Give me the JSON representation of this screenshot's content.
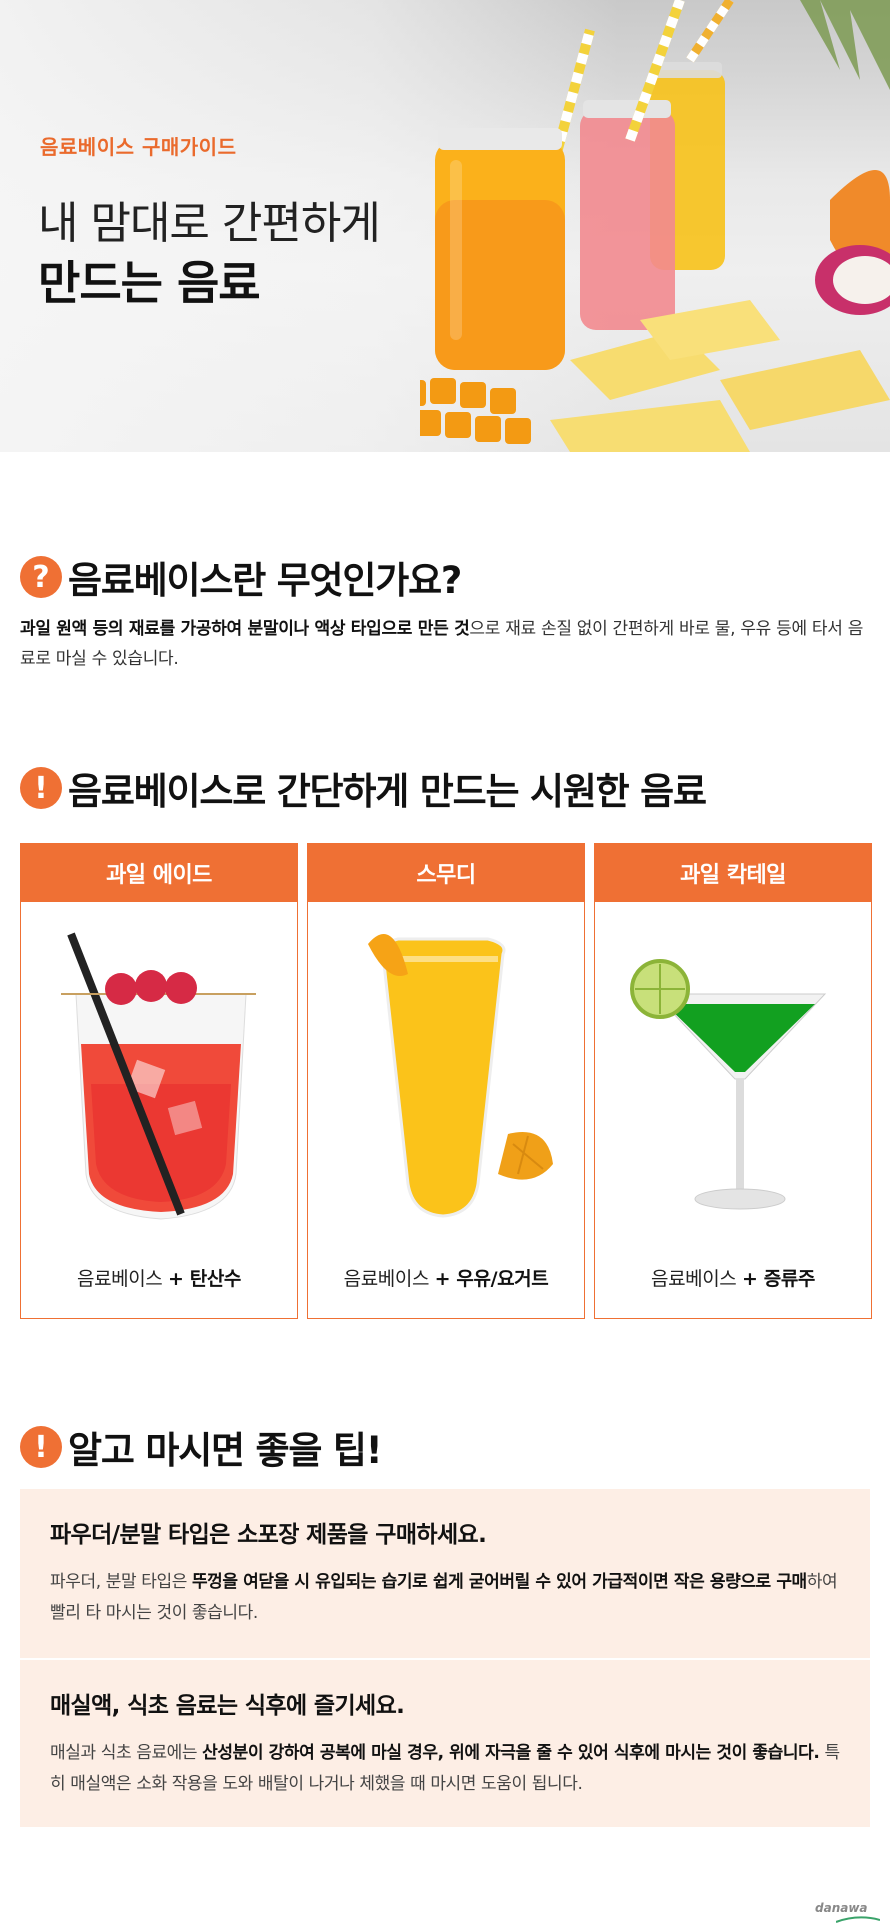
{
  "hero": {
    "subtitle": "음료베이스 구매가이드",
    "title_line1": "내 맘대로 간편하게",
    "title_line2": "만드는 음료"
  },
  "section1": {
    "icon": "question-icon",
    "badge": "?",
    "title": "음료베이스란 무엇인가요?",
    "body_bold": "과일 원액 등의 재료를 가공하여 분말이나 액상 타입으로 만든 것",
    "body_rest": "으로 재료 손질 없이 간편하게 바로 물, 우유 등에 타서 음료로 마실 수 있습니다."
  },
  "section2": {
    "icon": "exclamation-icon",
    "badge": "!",
    "title": "음료베이스로 간단하게 만드는 시원한 음료",
    "cards": [
      {
        "title": "과일 에이드",
        "caption_prefix": "음료베이스",
        "caption_suffix": "+ 탄산수",
        "icon": "ade-glass-icon"
      },
      {
        "title": "스무디",
        "caption_prefix": "음료베이스",
        "caption_suffix": "+ 우유/요거트",
        "icon": "smoothie-glass-icon"
      },
      {
        "title": "과일 칵테일",
        "caption_prefix": "음료베이스",
        "caption_suffix": "+ 증류주",
        "icon": "cocktail-glass-icon"
      }
    ]
  },
  "section3": {
    "icon": "exclamation-icon",
    "badge": "!",
    "title": "알고 마시면 좋을 팁!",
    "tips": [
      {
        "title": "파우더/분말 타입은 소포장 제품을 구매하세요.",
        "body_1": "파우더, 분말 타입은 ",
        "body_bold_1": "뚜껑을 여닫을 시 유입되는 습기로 쉽게 굳어버릴 수 있어 가급적이면 작은 용량으로 구매",
        "body_2": "하여 빨리 타 마시는 것이 좋습니다."
      },
      {
        "title": "매실액, 식초 음료는 식후에 즐기세요.",
        "body_1": "매실과 식초 음료에는 ",
        "body_bold_1": "산성분이 강하여 공복에 마실 경우, 위에 자극을 줄 수 있어 식후에 마시는 것이 좋습니다.",
        "body_2": " 특히 매실액은 소화 작용을 도와 배탈이 나거나 체했을 때 마시면 도움이 됩니다."
      }
    ]
  },
  "footer": {
    "logo": "danawa"
  },
  "colors": {
    "accent": "#ef7034",
    "tip_bg": "#fdeee5"
  }
}
